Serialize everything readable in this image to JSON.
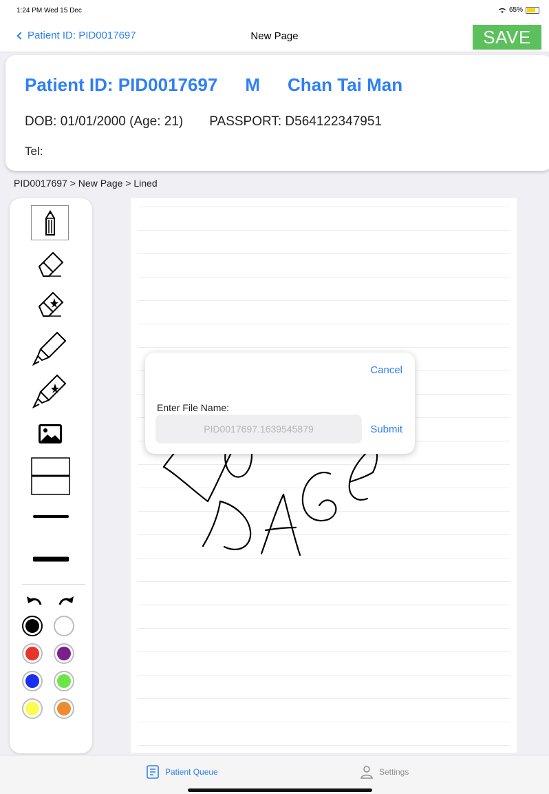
{
  "status_bar": {
    "time": "1:24 PM  Wed 15 Dec",
    "battery": "65%"
  },
  "nav": {
    "back_label": "Patient ID: PID0017697",
    "title": "New Page",
    "save_label": "SAVE"
  },
  "patient": {
    "pid": "Patient ID: PID0017697",
    "gender": "M",
    "name": "Chan Tai Man",
    "dob": "DOB: 01/01/2000 (Age: 21)",
    "passport": "PASSPORT: D564122347951",
    "tel": "Tel:"
  },
  "breadcrumb": "PID0017697  >  New Page  >  Lined",
  "tools": {
    "items": [
      "pencil-icon",
      "eraser-icon",
      "area-eraser-icon",
      "highlighter-icon",
      "area-highlighter-icon",
      "image-icon",
      "paper-lined-icon",
      "thin-line-icon",
      "thick-line-icon"
    ],
    "colors": [
      "#000000",
      "#ffffff",
      "#e8352c",
      "#7b1f8f",
      "#1a2ff0",
      "#6fe44a",
      "#fbfb52",
      "#ef8a32"
    ],
    "selected_color": "#000000"
  },
  "dialog": {
    "cancel_label": "Cancel",
    "label": "Enter File Name:",
    "placeholder": "PID0017697.1639545879",
    "submit_label": "Submit"
  },
  "tabbar": {
    "queue_label": "Patient Queue",
    "settings_label": "Settings"
  }
}
